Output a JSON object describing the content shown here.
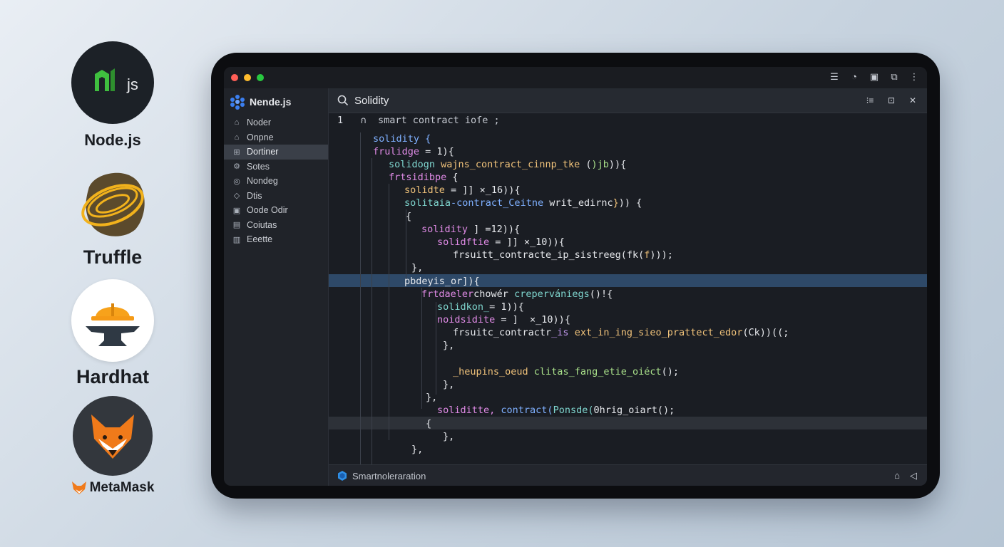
{
  "logos": [
    {
      "name": "Node.js",
      "mark_text": "js"
    },
    {
      "name": "Truffle"
    },
    {
      "name": "Hardhat"
    },
    {
      "name": "MetaMask"
    }
  ],
  "window": {
    "traffic_lights": [
      "#ff5f57",
      "#febc2e",
      "#28c840"
    ],
    "toolbar_icons": [
      "list-icon",
      "user-icon",
      "panel-icon",
      "external-icon",
      "more-icon"
    ]
  },
  "sidebar": {
    "title": "Nende.js",
    "items": [
      {
        "label": "Noder",
        "icon": "home-icon"
      },
      {
        "label": "Onpne",
        "icon": "home-icon"
      },
      {
        "label": "Dortiner",
        "icon": "grid-icon",
        "active": true
      },
      {
        "label": "Sotes",
        "icon": "gear-icon"
      },
      {
        "label": "Nondeg",
        "icon": "target-icon"
      },
      {
        "label": "Dtis",
        "icon": "diamond-icon"
      },
      {
        "label": "Oode Odir",
        "icon": "box-icon"
      },
      {
        "label": "Coiutas",
        "icon": "box-icon"
      },
      {
        "label": "Eeette",
        "icon": "box-icon"
      }
    ]
  },
  "editor": {
    "title": "Solidity",
    "header_icons": [
      "split-icon",
      "square-icon",
      "close-icon"
    ],
    "status_text": "Smartnoleraration",
    "code_lines": [
      [
        {
          "t": "1",
          "c": "ln"
        },
        {
          "t": "   ",
          "c": "c-white"
        },
        {
          "t": "ก  smart contract ioſe ;",
          "c": "c-cm"
        }
      ],
      [
        {
          "t": "solidity {",
          "c": "c-blue"
        }
      ],
      [
        {
          "t": "frulidge",
          "c": "c-pink"
        },
        {
          "t": " = 1){",
          "c": "c-white"
        }
      ],
      [
        {
          "t": "solidogn",
          "c": "c-teal"
        },
        {
          "t": " wajns_contract_cinnp_tke",
          "c": "c-orange"
        },
        {
          "t": " (",
          "c": "c-white"
        },
        {
          "t": ")jb",
          "c": "c-green"
        },
        {
          "t": ")){",
          "c": "c-white"
        }
      ],
      [
        {
          "t": "frtsidibpe",
          "c": "c-pink"
        },
        {
          "t": " {",
          "c": "c-white"
        }
      ],
      [
        {
          "t": "solidte",
          "c": "c-orange"
        },
        {
          "t": " = ]] ×_16)){",
          "c": "c-white"
        }
      ],
      [
        {
          "t": "solitaia",
          "c": "c-teal"
        },
        {
          "t": "-contract_Ceitne",
          "c": "c-blue"
        },
        {
          "t": " writ_edirnc",
          "c": "c-white"
        },
        {
          "t": "}",
          "c": "c-orange"
        },
        {
          "t": ")) {",
          "c": "c-white"
        }
      ],
      [
        {
          "t": "{",
          "c": "c-white"
        }
      ],
      [
        {
          "t": "solidity",
          "c": "c-pink"
        },
        {
          "t": " ] =12)){",
          "c": "c-white"
        }
      ],
      [
        {
          "t": "solidftie",
          "c": "c-pink"
        },
        {
          "t": " = ]] ×_10)){",
          "c": "c-white"
        }
      ],
      [
        {
          "t": "frsuitt_contracte",
          "c": "c-white"
        },
        {
          "t": "_ip_sistreeg",
          "c": "c-white"
        },
        {
          "t": "(fk(",
          "c": "c-white"
        },
        {
          "t": "f",
          "c": "c-orange"
        },
        {
          "t": ")));",
          "c": "c-white"
        }
      ],
      [
        {
          "t": "},",
          "c": "c-white"
        }
      ],
      [
        {
          "t": "pbdeyis_or",
          "c": "c-white"
        },
        {
          "t": "]){",
          "c": "c-white"
        }
      ],
      [
        {
          "t": "frtdaeler",
          "c": "c-pink"
        },
        {
          "t": "chowér",
          "c": "c-white"
        },
        {
          "t": " crepervániegs",
          "c": "c-teal"
        },
        {
          "t": "()!{",
          "c": "c-white"
        }
      ],
      [
        {
          "t": "solidkon_",
          "c": "c-teal"
        },
        {
          "t": "= 1)){",
          "c": "c-white"
        }
      ],
      [
        {
          "t": "noidsidite",
          "c": "c-pink"
        },
        {
          "t": " = ]  ×_10)){",
          "c": "c-white"
        }
      ],
      [
        {
          "t": "frsuitc_contractr",
          "c": "c-white"
        },
        {
          "t": "_is",
          "c": "c-purple"
        },
        {
          "t": " ext_in_ing_sieo_prattect_edor",
          "c": "c-orange"
        },
        {
          "t": "(Ck))((;",
          "c": "c-white"
        }
      ],
      [
        {
          "t": "},",
          "c": "c-white"
        }
      ],
      [
        {
          "t": "",
          "c": "c-white"
        }
      ],
      [
        {
          "t": "_heupins_oeud",
          "c": "c-orange"
        },
        {
          "t": " clitas_fang_etie_oiéct",
          "c": "c-green"
        },
        {
          "t": "();",
          "c": "c-white"
        }
      ],
      [
        {
          "t": "},",
          "c": "c-white"
        }
      ],
      [
        {
          "t": "},",
          "c": "c-white"
        }
      ],
      [
        {
          "t": "soliditte,",
          "c": "c-pink"
        },
        {
          "t": " contract(",
          "c": "c-blue"
        },
        {
          "t": "Ponsde(",
          "c": "c-teal"
        },
        {
          "t": "0hrig_oiart();",
          "c": "c-white"
        }
      ],
      [
        {
          "t": "{",
          "c": "c-white"
        }
      ],
      [
        {
          "t": "},",
          "c": "c-white"
        }
      ],
      [
        {
          "t": "},",
          "c": "c-white"
        }
      ]
    ]
  }
}
